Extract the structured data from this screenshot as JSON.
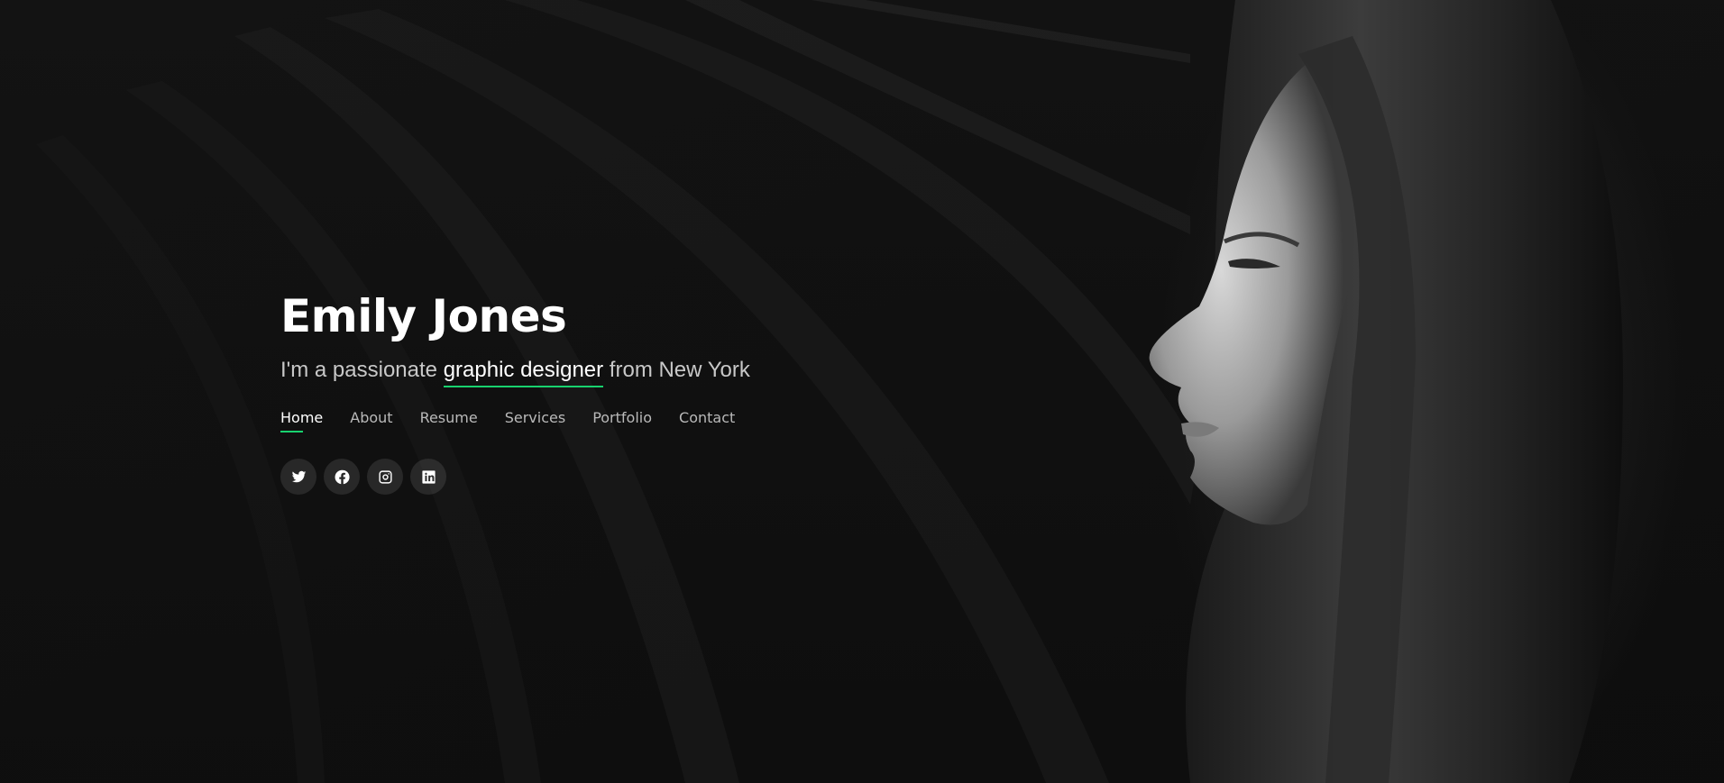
{
  "hero": {
    "name": "Emily Jones",
    "tagline_prefix": "I'm a passionate ",
    "tagline_typed": "graphic designer",
    "tagline_suffix": " from New York"
  },
  "nav": {
    "items": [
      {
        "label": "Home",
        "active": true
      },
      {
        "label": "About"
      },
      {
        "label": "Resume"
      },
      {
        "label": "Services"
      },
      {
        "label": "Portfolio"
      },
      {
        "label": "Contact"
      }
    ]
  },
  "social": {
    "links": [
      {
        "icon": "twitter-icon"
      },
      {
        "icon": "facebook-icon"
      },
      {
        "icon": "instagram-icon"
      },
      {
        "icon": "linkedin-icon"
      }
    ]
  },
  "colors": {
    "accent": "#18d26e",
    "background": "#0b0b0b",
    "text_primary": "#ffffff",
    "text_secondary": "#c8c8c8"
  }
}
